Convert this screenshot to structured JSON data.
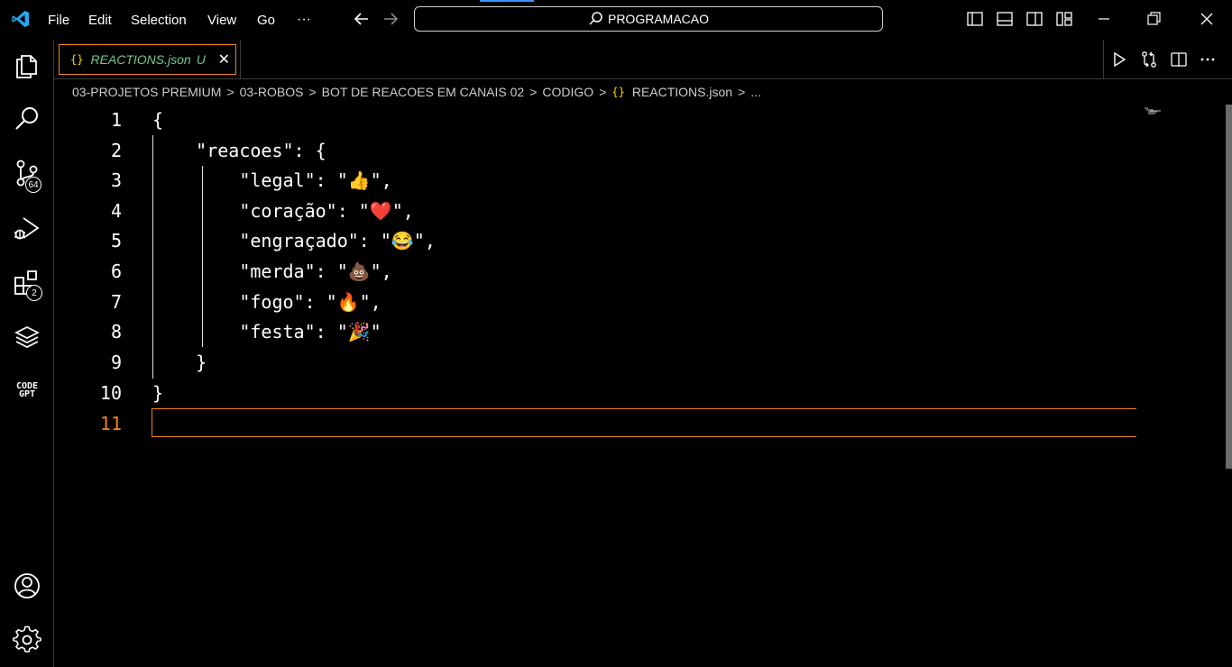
{
  "menu": {
    "file": "File",
    "edit": "Edit",
    "selection": "Selection",
    "view": "View",
    "go": "Go",
    "more": "···"
  },
  "search": {
    "text": "PROGRAMACAO"
  },
  "activity_bar": {
    "source_control_badge": "64",
    "extensions_badge": "2",
    "codegpt_line1": "CODE",
    "codegpt_line2": "GPT"
  },
  "tab": {
    "icon": "{}",
    "name": "REACTIONS.json",
    "status": "U",
    "close": "✕"
  },
  "breadcrumb": {
    "items": [
      "03-PROJETOS PREMIUM",
      "03-ROBOS",
      "BOT DE REACOES EM CANAIS 02",
      "CODIGO"
    ],
    "file_icon": "{}",
    "file": "REACTIONS.json",
    "trail": "..."
  },
  "editor": {
    "line_numbers": [
      "1",
      "2",
      "3",
      "4",
      "5",
      "6",
      "7",
      "8",
      "9",
      "10",
      "11"
    ],
    "active_line": "11",
    "lines": [
      "{",
      "    \"reacoes\": {",
      "        \"legal\": \"👍\",",
      "        \"coração\": \"❤️\",",
      "        \"engraçado\": \"😂\",",
      "        \"merda\": \"💩\",",
      "        \"fogo\": \"🔥\",",
      "        \"festa\": \"🎉\"",
      "    }",
      "}",
      ""
    ]
  },
  "colors": {
    "accent_orange": "#f38518",
    "modified_green": "#73c991",
    "json_braces": "#ffd700",
    "blue_accent": "#3794ff"
  }
}
